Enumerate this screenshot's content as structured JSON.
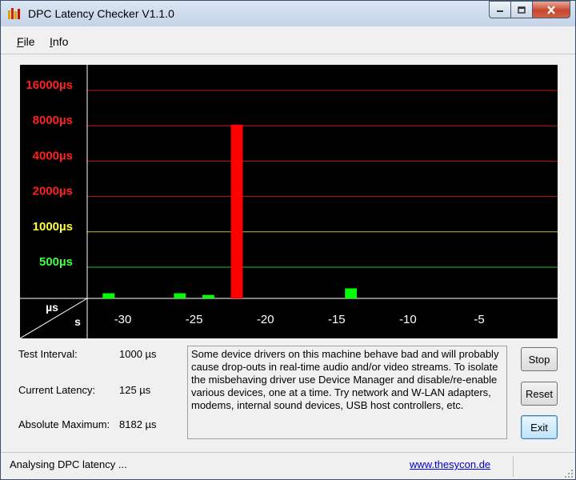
{
  "window": {
    "title": "DPC Latency Checker V1.1.0"
  },
  "menu": {
    "file": {
      "mnemonic": "F",
      "rest": "ile"
    },
    "info": {
      "mnemonic": "I",
      "rest": "nfo"
    }
  },
  "colors": {
    "good": "#00ff00",
    "warning": "#ffff00",
    "bad": "#ff0000",
    "chart_bg": "#000000"
  },
  "chart_data": {
    "type": "bar",
    "y_ticks": [
      {
        "label": "16000µs",
        "value": 16000,
        "color": "#ff2020"
      },
      {
        "label": "8000µs",
        "value": 8000,
        "color": "#ff2020"
      },
      {
        "label": "4000µs",
        "value": 4000,
        "color": "#ff2020"
      },
      {
        "label": "2000µs",
        "value": 2000,
        "color": "#ff2020"
      },
      {
        "label": "1000µs",
        "value": 1000,
        "color": "#ffff40"
      },
      {
        "label": "500µs",
        "value": 500,
        "color": "#40ff40"
      }
    ],
    "x_ticks": [
      "-30",
      "-25",
      "-20",
      "-15",
      "-10",
      "-5"
    ],
    "x_tick_values": [
      -30,
      -25,
      -20,
      -15,
      -10,
      -5
    ],
    "xlim": [
      -33,
      0
    ],
    "ylabel": "µs",
    "xlabel": "s",
    "values_us": [
      190,
      300,
      125,
      180,
      210,
      200,
      300,
      230,
      290,
      150,
      8182,
      110,
      120,
      110,
      170,
      120,
      230,
      150,
      330,
      180,
      150,
      120,
      120,
      210,
      220,
      170,
      120,
      100,
      170,
      120,
      120,
      100,
      90
    ],
    "bar_colors": [
      "good",
      "good",
      "good",
      "good",
      "good",
      "good",
      "good",
      "good",
      "good",
      "good",
      "bad",
      "good",
      "good",
      "good",
      "good",
      "good",
      "good",
      "good",
      "good",
      "good",
      "good",
      "good",
      "good",
      "good",
      "good",
      "good",
      "good",
      "good",
      "good",
      "good",
      "good",
      "good",
      "good"
    ],
    "scale": "log2",
    "grid": true
  },
  "stats": {
    "test_interval": {
      "label": "Test Interval:",
      "value": "1000 µs"
    },
    "current_latency": {
      "label": "Current Latency:",
      "value": "125 µs"
    },
    "absolute_maximum": {
      "label": "Absolute Maximum:",
      "value": "8182 µs"
    }
  },
  "message": "Some device drivers on this machine behave bad and will probably cause drop-outs in real-time audio and/or video streams. To isolate the misbehaving driver use Device Manager and disable/re-enable various devices, one at a time. Try network and W-LAN adapters, modems, internal sound devices, USB host controllers, etc.",
  "buttons": {
    "stop": "Stop",
    "reset": "Reset",
    "exit": "Exit"
  },
  "status": {
    "text": "Analysing DPC latency ...",
    "link": "www.thesycon.de"
  }
}
